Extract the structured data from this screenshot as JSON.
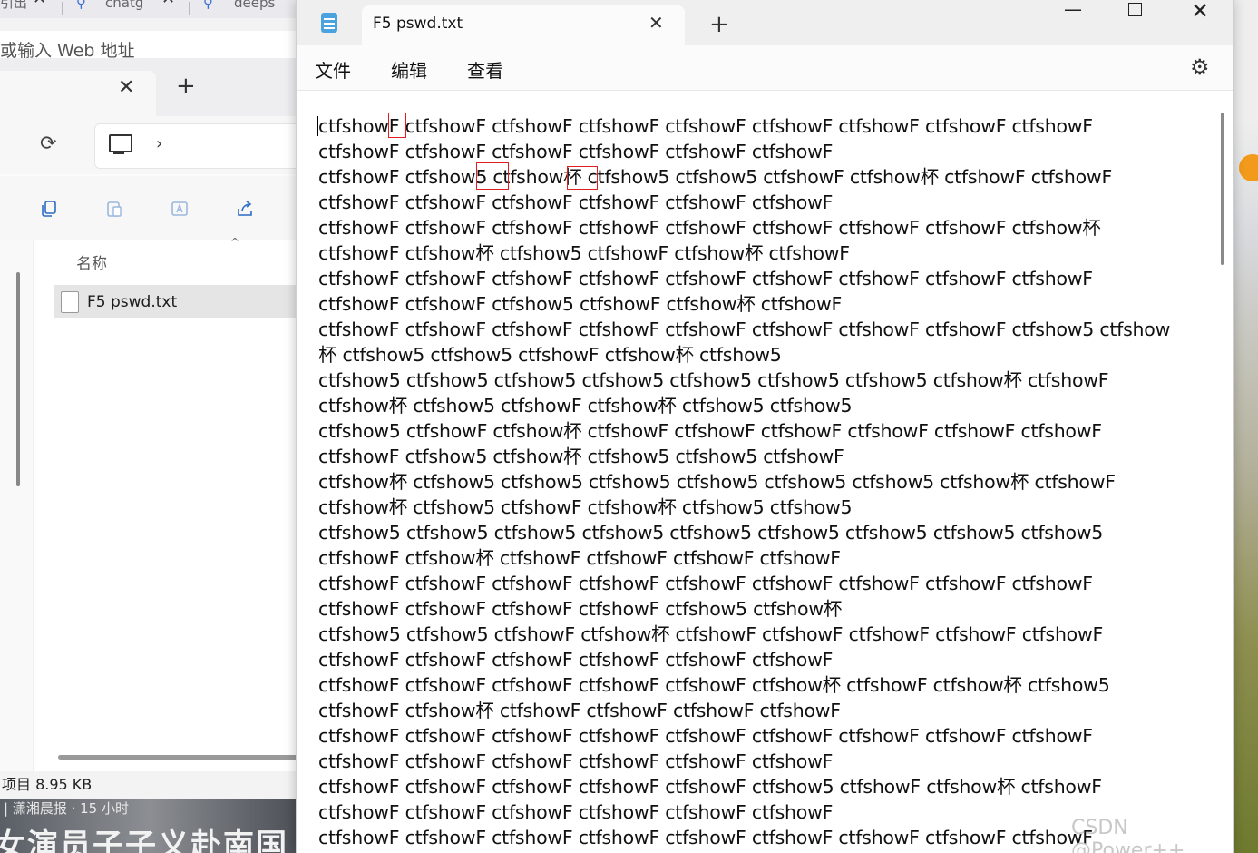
{
  "browser": {
    "tabs": [
      {
        "label": "引出",
        "close": "✕"
      },
      {
        "label": "chatg",
        "close": "✕"
      },
      {
        "label": "deeps",
        "close": ""
      }
    ],
    "address_placeholder": "或输入 Web 地址"
  },
  "explorer": {
    "tab_close": "✕",
    "new_tab": "+",
    "refresh_icon": "⟳",
    "chevron": "›",
    "column_name": "名称",
    "sort_indicator": "^",
    "file_name": "F5 pswd.txt",
    "status": "项目  8.95 KB"
  },
  "news": {
    "meta": "| 潇湘晨报 · 15 小时",
    "headline": "女演员子子义赴南国"
  },
  "notepad": {
    "tab_title": "F5 pswd.txt",
    "tab_close": "✕",
    "new_tab": "+",
    "minimize": "—",
    "close": "✕",
    "menus": [
      "文件",
      "编辑",
      "查看"
    ],
    "settings_icon": "⚙",
    "lines": [
      "ctfshowF ctfshowF ctfshowF ctfshowF ctfshowF ctfshowF ctfshowF ctfshowF ctfshowF",
      "ctfshowF ctfshowF ctfshowF ctfshowF ctfshowF ctfshowF",
      "ctfshowF ctfshow5 ctfshow杯 ctfshow5 ctfshow5 ctfshowF ctfshow杯 ctfshowF ctfshowF",
      "ctfshowF ctfshowF ctfshowF ctfshowF ctfshowF ctfshowF",
      "ctfshowF ctfshowF ctfshowF ctfshowF ctfshowF ctfshowF ctfshowF ctfshowF ctfshow杯",
      "ctfshowF ctfshow杯 ctfshow5 ctfshowF ctfshow杯 ctfshowF",
      "ctfshowF ctfshowF ctfshowF ctfshowF ctfshowF ctfshowF ctfshowF ctfshowF ctfshowF",
      "ctfshowF ctfshowF ctfshow5 ctfshowF ctfshow杯 ctfshowF",
      "ctfshowF ctfshowF ctfshowF ctfshowF ctfshowF ctfshowF ctfshowF ctfshowF ctfshow5 ctfshow",
      "杯 ctfshow5 ctfshow5 ctfshowF ctfshow杯 ctfshow5",
      "ctfshow5 ctfshow5 ctfshow5 ctfshow5 ctfshow5 ctfshow5 ctfshow5 ctfshow杯 ctfshowF",
      "ctfshow杯 ctfshow5 ctfshowF ctfshow杯 ctfshow5 ctfshow5",
      "ctfshow5 ctfshowF ctfshow杯 ctfshowF ctfshowF ctfshowF ctfshowF ctfshowF ctfshowF",
      "ctfshowF ctfshow5 ctfshow杯 ctfshow5 ctfshow5 ctfshowF",
      "ctfshow杯 ctfshow5 ctfshow5 ctfshow5 ctfshow5 ctfshow5 ctfshow5 ctfshow杯 ctfshowF",
      "ctfshow杯 ctfshow5 ctfshowF ctfshow杯 ctfshow5 ctfshow5",
      "ctfshow5 ctfshow5 ctfshow5 ctfshow5 ctfshow5 ctfshow5 ctfshow5 ctfshow5 ctfshow5",
      "ctfshowF ctfshow杯 ctfshowF ctfshowF ctfshowF ctfshowF",
      "ctfshowF ctfshowF ctfshowF ctfshowF ctfshowF ctfshowF ctfshowF ctfshowF ctfshowF",
      "ctfshowF ctfshowF ctfshowF ctfshowF ctfshow5 ctfshow杯",
      "ctfshow5 ctfshow5 ctfshowF ctfshow杯 ctfshowF ctfshowF ctfshowF ctfshowF ctfshowF",
      "ctfshowF ctfshowF ctfshowF ctfshowF ctfshowF ctfshowF",
      "ctfshowF ctfshowF ctfshowF ctfshowF ctfshowF ctfshow杯 ctfshowF ctfshow杯 ctfshow5",
      "ctfshowF ctfshow杯 ctfshowF ctfshowF ctfshowF ctfshowF",
      "ctfshowF ctfshowF ctfshowF ctfshowF ctfshowF ctfshowF ctfshowF ctfshowF ctfshowF",
      "ctfshowF ctfshowF ctfshowF ctfshowF ctfshowF ctfshowF",
      "ctfshowF ctfshowF ctfshowF ctfshowF ctfshowF ctfshow5 ctfshowF ctfshow杯 ctfshowF",
      "ctfshowF ctfshowF ctfshowF ctfshowF ctfshowF ctfshowF",
      "ctfshowF ctfshowF ctfshowF ctfshowF ctfshowF ctfshowF ctfshowF ctfshowF ctfshowF"
    ]
  },
  "watermark": "CSDN @Power++",
  "colors": {
    "highlight_box": "#e02020",
    "notepad_icon": "#4aa3df",
    "selected_file_row": "#e5e5e5"
  }
}
